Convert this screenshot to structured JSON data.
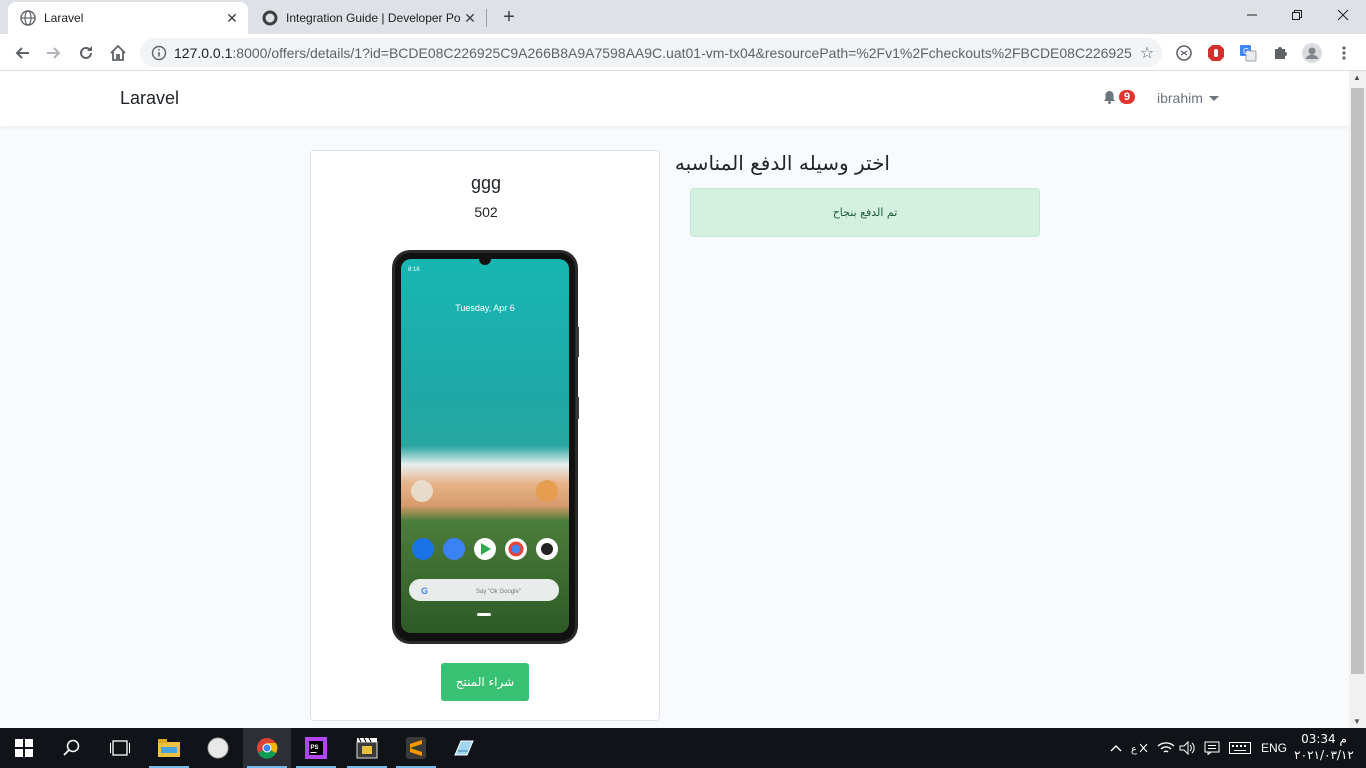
{
  "browser": {
    "tabs": [
      {
        "title": "Laravel",
        "active": true
      },
      {
        "title": "Integration Guide | Developer Po",
        "active": false
      }
    ],
    "url_host": "127.0.0.1",
    "url_rest": ":8000/offers/details/1?id=BCDE08C226925C9A266B8A9A7598AA9C.uat01-vm-tx04&resourcePath=%2Fv1%2Fcheckouts%2FBCDE08C226925C...",
    "window_controls": [
      "minimize",
      "restore",
      "close"
    ]
  },
  "navbar": {
    "brand": "Laravel",
    "notification_count": "9",
    "user_name": "ibrahim"
  },
  "product": {
    "name": "ggg",
    "price": "502",
    "image_icon": "smartphone-image",
    "phone_time": "8:16",
    "phone_date": "Tuesday, Apr 6",
    "search_hint": "Say \"Ok Google\"",
    "buy_label": "شراء المنتج"
  },
  "payment": {
    "heading": "اختر وسيله الدفع المناسبه",
    "success_message": "تم الدفع بنجاح"
  },
  "colors": {
    "success_button": "#38c172",
    "alert_bg": "#d4f0e0",
    "badge": "#e3342f"
  },
  "taskbar": {
    "apps": [
      "start-icon",
      "search-icon",
      "task-view-icon",
      "file-explorer-icon",
      "compass-app-icon",
      "chrome-icon",
      "phpstorm-icon",
      "media-app-icon",
      "sublime-icon",
      "notepad-icon"
    ],
    "language": "ENG",
    "time": "03:34 م",
    "date": "٢٠٢١/٠٣/١٢"
  }
}
